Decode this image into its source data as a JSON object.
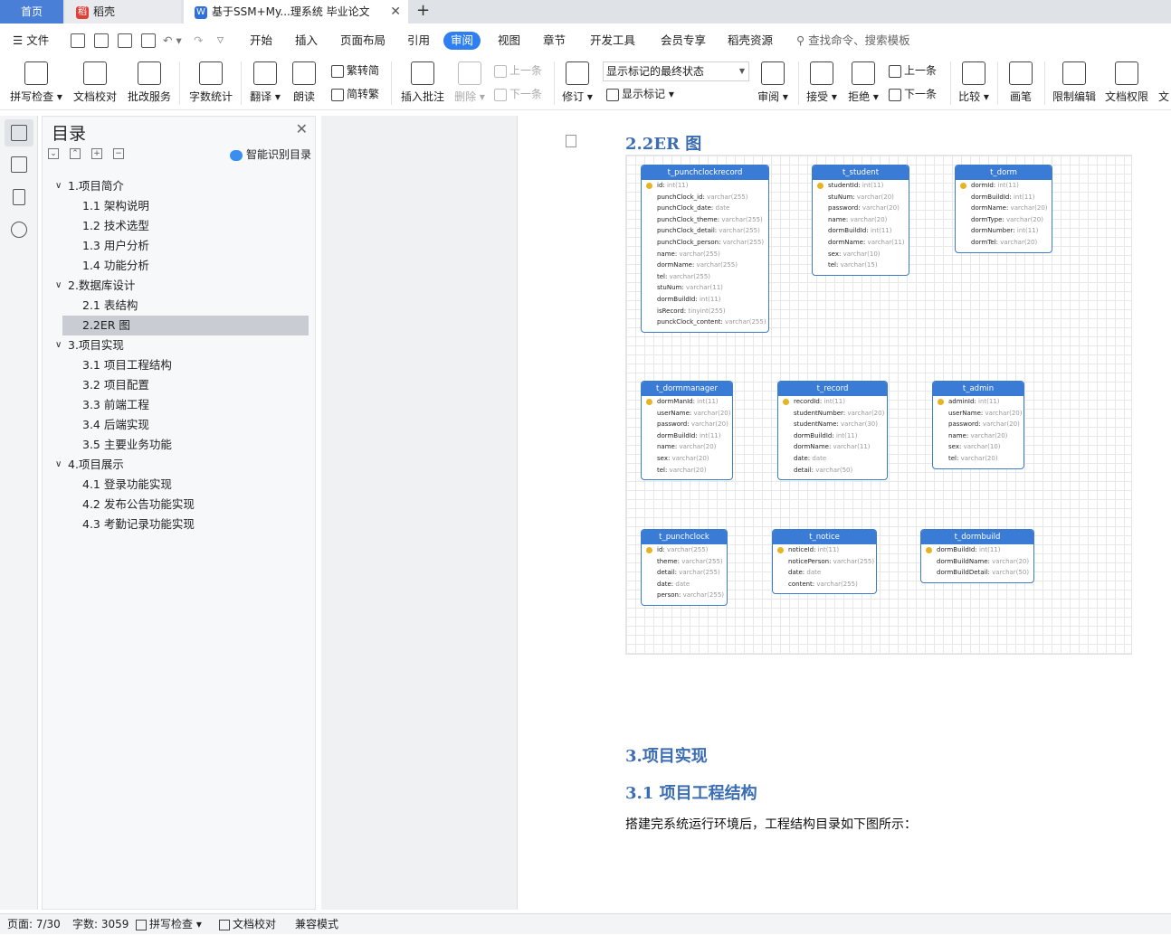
{
  "tabs": {
    "home": "首页",
    "daoke": "稻壳",
    "doc": "基于SSM+My...理系统 毕业论文"
  },
  "menu": {
    "file": "文件",
    "items": [
      "开始",
      "插入",
      "页面布局",
      "引用",
      "审阅",
      "视图",
      "章节",
      "开发工具",
      "会员专享",
      "稻壳资源"
    ],
    "active": "审阅",
    "search": "查找命令、搜索模板"
  },
  "ribbon": {
    "spell": "拼写检查",
    "proof": "文档校对",
    "correct": "批改服务",
    "wordcount": "字数统计",
    "translate": "翻译",
    "read": "朗读",
    "trad": "繁转简",
    "simp": "简转繁",
    "insert_comment": "插入批注",
    "delete": "删除",
    "prev": "上一条",
    "next": "下一条",
    "revise": "修订",
    "markup_state": "显示标记的最终状态",
    "show_markup": "显示标记",
    "review": "审阅",
    "accept": "接受",
    "reject": "拒绝",
    "prev2": "上一条",
    "next2": "下一条",
    "compare": "比较",
    "pen": "画笔",
    "restrict": "限制编辑",
    "perm": "文档权限",
    "cut": "文"
  },
  "toc": {
    "title": "目录",
    "smart": "智能识别目录",
    "items": [
      {
        "label": "1.项目简介",
        "level": 1
      },
      {
        "label": "1.1 架构说明",
        "level": 2
      },
      {
        "label": "1.2 技术选型",
        "level": 2
      },
      {
        "label": "1.3 用户分析",
        "level": 2
      },
      {
        "label": "1.4 功能分析",
        "level": 2
      },
      {
        "label": "2.数据库设计",
        "level": 1
      },
      {
        "label": "2.1 表结构",
        "level": 2
      },
      {
        "label": "2.2ER 图",
        "level": 2,
        "selected": true
      },
      {
        "label": "3.项目实现",
        "level": 1
      },
      {
        "label": "3.1 项目工程结构",
        "level": 2
      },
      {
        "label": "3.2 项目配置",
        "level": 2
      },
      {
        "label": "3.3 前端工程",
        "level": 2
      },
      {
        "label": "3.4 后端实现",
        "level": 2
      },
      {
        "label": "3.5 主要业务功能",
        "level": 2
      },
      {
        "label": "4.项目展示",
        "level": 1
      },
      {
        "label": "4.1  登录功能实现",
        "level": 2
      },
      {
        "label": "4.2  发布公告功能实现",
        "level": 2
      },
      {
        "label": "4.3  考勤记录功能实现",
        "level": 2
      }
    ]
  },
  "doc": {
    "h_er": "2.2ER 图",
    "h1": "3.项目实现",
    "h2": "3.1 项目工程结构",
    "para": "搭建完系统运行环境后，工程结构目录如下图所示："
  },
  "er_tables": [
    {
      "name": "t_punchclockrecord",
      "fields": [
        [
          "id",
          "int(11)",
          true
        ],
        [
          "punchClock_id",
          "varchar(255)"
        ],
        [
          "punchClock_date",
          "date"
        ],
        [
          "punchClock_theme",
          "varchar(255)"
        ],
        [
          "punchClock_detail",
          "varchar(255)"
        ],
        [
          "punchClock_person",
          "varchar(255)"
        ],
        [
          "name",
          "varchar(255)"
        ],
        [
          "dormName",
          "varchar(255)"
        ],
        [
          "tel",
          "varchar(255)"
        ],
        [
          "stuNum",
          "varchar(11)"
        ],
        [
          "dormBuildId",
          "int(11)"
        ],
        [
          "isRecord",
          "tinyint(255)"
        ],
        [
          "punckClock_content",
          "varchar(255)"
        ]
      ]
    },
    {
      "name": "t_student",
      "fields": [
        [
          "studentId",
          "int(11)",
          true
        ],
        [
          "stuNum",
          "varchar(20)"
        ],
        [
          "password",
          "varchar(20)"
        ],
        [
          "name",
          "varchar(20)"
        ],
        [
          "dormBuildId",
          "int(11)"
        ],
        [
          "dormName",
          "varchar(11)"
        ],
        [
          "sex",
          "varchar(10)"
        ],
        [
          "tel",
          "varchar(15)"
        ]
      ]
    },
    {
      "name": "t_dorm",
      "fields": [
        [
          "dormId",
          "int(11)",
          true
        ],
        [
          "dormBuildId",
          "int(11)"
        ],
        [
          "dormName",
          "varchar(20)"
        ],
        [
          "dormType",
          "varchar(20)"
        ],
        [
          "dormNumber",
          "int(11)"
        ],
        [
          "dormTel",
          "varchar(20)"
        ]
      ]
    },
    {
      "name": "t_dormmanager",
      "fields": [
        [
          "dormManId",
          "int(11)",
          true
        ],
        [
          "userName",
          "varchar(20)"
        ],
        [
          "password",
          "varchar(20)"
        ],
        [
          "dormBuildId",
          "int(11)"
        ],
        [
          "name",
          "varchar(20)"
        ],
        [
          "sex",
          "varchar(20)"
        ],
        [
          "tel",
          "varchar(20)"
        ]
      ]
    },
    {
      "name": "t_record",
      "fields": [
        [
          "recordId",
          "int(11)",
          true
        ],
        [
          "studentNumber",
          "varchar(20)"
        ],
        [
          "studentName",
          "varchar(30)"
        ],
        [
          "dormBuildId",
          "int(11)"
        ],
        [
          "dormName",
          "varchar(11)"
        ],
        [
          "date",
          "date"
        ],
        [
          "detail",
          "varchar(50)"
        ]
      ]
    },
    {
      "name": "t_admin",
      "fields": [
        [
          "adminId",
          "int(11)",
          true
        ],
        [
          "userName",
          "varchar(20)"
        ],
        [
          "password",
          "varchar(20)"
        ],
        [
          "name",
          "varchar(20)"
        ],
        [
          "sex",
          "varchar(10)"
        ],
        [
          "tel",
          "varchar(20)"
        ]
      ]
    },
    {
      "name": "t_punchclock",
      "fields": [
        [
          "id",
          "varchar(255)",
          true
        ],
        [
          "theme",
          "varchar(255)"
        ],
        [
          "detail",
          "varchar(255)"
        ],
        [
          "date",
          "date"
        ],
        [
          "person",
          "varchar(255)"
        ]
      ]
    },
    {
      "name": "t_notice",
      "fields": [
        [
          "noticeId",
          "int(11)",
          true
        ],
        [
          "noticePerson",
          "varchar(255)"
        ],
        [
          "date",
          "date"
        ],
        [
          "content",
          "varchar(255)"
        ]
      ]
    },
    {
      "name": "t_dormbuild",
      "fields": [
        [
          "dormBuildId",
          "int(11)",
          true
        ],
        [
          "dormBuildName",
          "varchar(20)"
        ],
        [
          "dormBuildDetail",
          "varchar(50)"
        ]
      ]
    }
  ],
  "status": {
    "page": "页面: 7/30",
    "words": "字数: 3059",
    "spell": "拼写检查",
    "proof": "文档校对",
    "compat": "兼容模式"
  }
}
